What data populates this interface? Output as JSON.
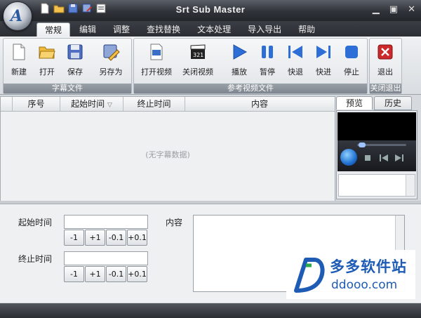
{
  "window": {
    "title": "Srt Sub Master"
  },
  "quick_access": [
    "new-icon",
    "open-icon",
    "save-icon",
    "save-as-icon",
    "export-icon"
  ],
  "tabs": [
    "常规",
    "编辑",
    "调整",
    "查找替换",
    "文本处理",
    "导入导出",
    "帮助"
  ],
  "groups": {
    "subtitle_file": {
      "title": "字幕文件",
      "buttons": [
        "新建",
        "打开",
        "保存",
        "另存为"
      ]
    },
    "reference_video": {
      "title": "参考视频文件",
      "buttons": [
        "打开视频",
        "关闭视频",
        "播放",
        "暂停",
        "快退",
        "快进",
        "停止"
      ]
    },
    "close_exit": {
      "title": "关闭退出",
      "buttons": [
        "退出"
      ]
    }
  },
  "table": {
    "columns": [
      "序号",
      "起始时间",
      "终止时间",
      "内容"
    ],
    "empty_text": "(无字幕数据)"
  },
  "preview": {
    "tabs": [
      "预览",
      "历史"
    ]
  },
  "edit": {
    "start_label": "起始时间",
    "end_label": "终止时间",
    "content_label": "内容",
    "step_buttons": [
      "-1",
      "+1",
      "-0.1",
      "+0.1"
    ]
  },
  "watermark": {
    "cn": "多多软件站",
    "en": "ddooo.com"
  },
  "colors": {
    "accent_blue": "#2d6fd6",
    "title_bar": "#2f3238",
    "exit_red": "#cc2a2a"
  }
}
